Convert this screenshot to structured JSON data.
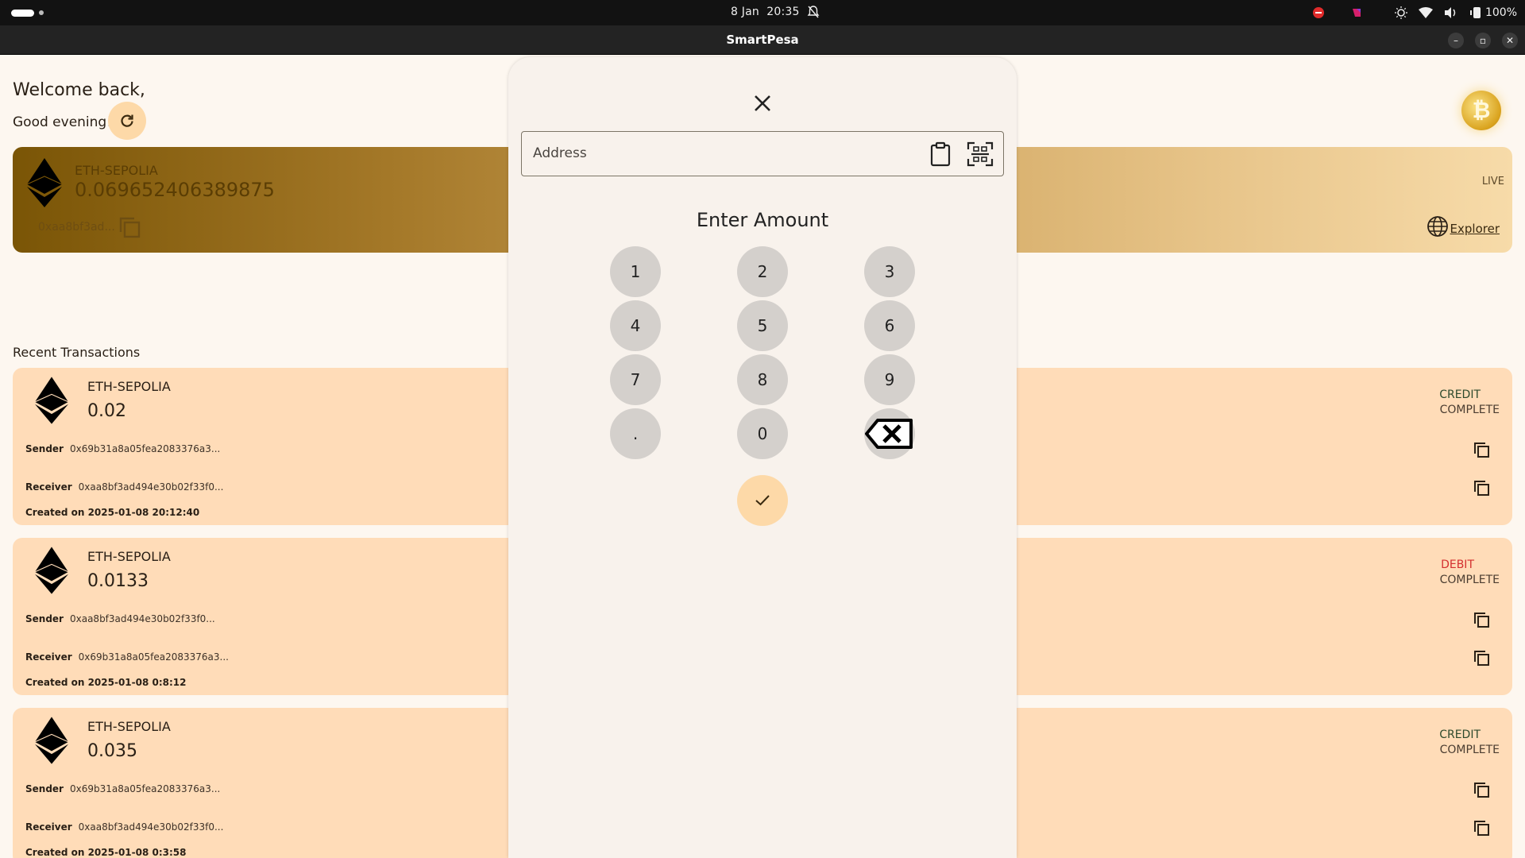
{
  "system_bar": {
    "date": "8 Jan",
    "time": "20:35",
    "battery": "100%"
  },
  "window": {
    "title": "SmartPesa",
    "minimize": "–",
    "maximize": "▫",
    "close": "✕"
  },
  "home": {
    "welcome": "Welcome back,",
    "greeting": "Good evening!",
    "coin_symbol": "₿",
    "wallet": {
      "network": "ETH-SEPOLIA",
      "balance": "0.069652406389875",
      "address": "0xaa8bf3ad...",
      "status": "LIVE",
      "explorer_link": "Explorer"
    },
    "recent_title": "Recent Transactions",
    "transactions": [
      {
        "network": "ETH-SEPOLIA",
        "amount": "0.02",
        "sender_label": "Sender",
        "sender": "0x69b31a8a05fea2083376a3...",
        "receiver_label": "Receiver",
        "receiver": "0xaa8bf3ad494e30b02f33f0...",
        "created": "Created on 2025-01-08 20:12:40",
        "type": "CREDIT",
        "type_color": "#2d4a2d",
        "status": "COMPLETE"
      },
      {
        "network": "ETH-SEPOLIA",
        "amount": "0.0133",
        "sender_label": "Sender",
        "sender": "0xaa8bf3ad494e30b02f33f0...",
        "receiver_label": "Receiver",
        "receiver": "0x69b31a8a05fea2083376a3...",
        "created": "Created on 2025-01-08 0:8:12",
        "type": "DEBIT",
        "type_color": "#d32f2f",
        "status": "COMPLETE"
      },
      {
        "network": "ETH-SEPOLIA",
        "amount": "0.035",
        "sender_label": "Sender",
        "sender": "0x69b31a8a05fea2083376a3...",
        "receiver_label": "Receiver",
        "receiver": "0xaa8bf3ad494e30b02f33f0...",
        "created": "Created on 2025-01-08 0:3:58",
        "type": "CREDIT",
        "type_color": "#2d4a2d",
        "status": "COMPLETE"
      }
    ]
  },
  "send_sheet": {
    "address_placeholder": "Address",
    "address_value": "",
    "title": "Enter Amount",
    "keys": [
      "1",
      "2",
      "3",
      "4",
      "5",
      "6",
      "7",
      "8",
      "9",
      ".",
      "0"
    ]
  },
  "colors": {
    "accent": "#fdd9a8",
    "tx_card": "#ffdcb8",
    "sheet_bg": "#f8f2ec",
    "key_bg": "#d4d0cc",
    "debit": "#d32f2f"
  },
  "icons": {
    "close": "close-icon",
    "paste": "clipboard-icon",
    "scan": "qr-scan-icon",
    "backspace": "backspace-icon",
    "confirm": "check-icon",
    "refresh": "refresh-icon",
    "copy": "copy-icon",
    "globe": "globe-icon",
    "eth": "ethereum-icon"
  }
}
